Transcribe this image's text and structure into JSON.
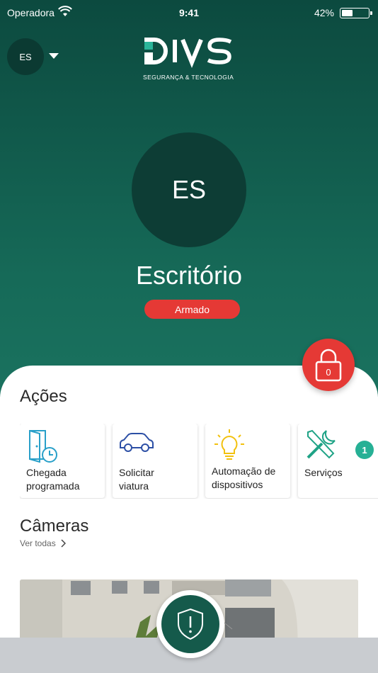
{
  "status_bar": {
    "carrier": "Operadora",
    "time": "9:41",
    "battery_percent": "42%",
    "battery_level": 0.42
  },
  "header": {
    "account_initials": "ES",
    "logo_text": "SEGURANÇA & TECNOLOGIA",
    "logo_icon": "divs-logo"
  },
  "site": {
    "initials": "ES",
    "name": "Escritório",
    "status": "Armado",
    "status_color": "#e53935"
  },
  "lock": {
    "count": "0",
    "icon": "lock-icon"
  },
  "actions": {
    "title": "Ações",
    "items": [
      {
        "label_line1": "Chegada",
        "label_line2": "programada",
        "icon": "door-clock-icon"
      },
      {
        "label_line1": "Solicitar",
        "label_line2": "viatura",
        "icon": "car-icon"
      },
      {
        "label_line1": "Automação de",
        "label_line2": "dispositivos",
        "icon": "lightbulb-icon"
      },
      {
        "label_line1": "Serviços",
        "label_line2": "",
        "icon": "tools-icon",
        "badge": "1"
      }
    ]
  },
  "cameras": {
    "title": "Câmeras",
    "see_all": "Ver todas"
  },
  "panic": {
    "icon": "shield-alert-icon"
  },
  "colors": {
    "primary": "#166a58",
    "accent": "#26b095",
    "alarm": "#e53935"
  }
}
